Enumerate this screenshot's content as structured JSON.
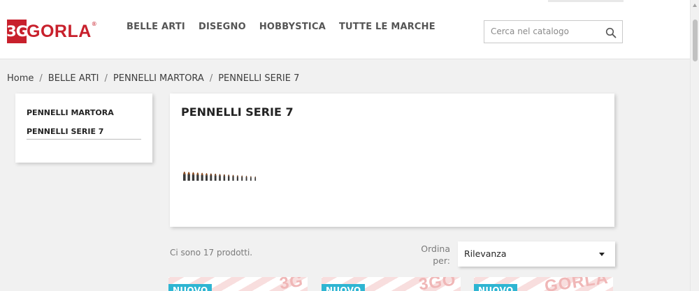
{
  "header": {
    "logo": {
      "prefix": "3G",
      "brand": "GORLA",
      "registered": "®"
    },
    "nav": [
      {
        "label": "BELLE ARTI"
      },
      {
        "label": "DISEGNO"
      },
      {
        "label": "HOBBYSTICA"
      },
      {
        "label": "TUTTE LE MARCHE"
      }
    ],
    "search": {
      "placeholder": "Cerca nel catalogo",
      "value": "",
      "icon": "search-icon"
    }
  },
  "breadcrumb": [
    "Home",
    "BELLE ARTI",
    "PENNELLI MARTORA",
    "PENNELLI SERIE 7"
  ],
  "breadcrumb_separator": "/",
  "sidebar": {
    "items": [
      {
        "label": "PENNELLI MARTORA"
      },
      {
        "label": "PENNELLI SERIE 7"
      }
    ]
  },
  "category": {
    "title": "PENNELLI SERIE 7",
    "image": "brushes-series-image"
  },
  "listing": {
    "count_text": "Ci sono 17 prodotti.",
    "sort_label": "Ordina per:",
    "sort_value": "Rilevanza"
  },
  "products": [
    {
      "badge": "NUOVO",
      "watermark": "3G"
    },
    {
      "badge": "NUOVO",
      "watermark": "3GO"
    },
    {
      "badge": "NUOVO",
      "watermark": "GORLA"
    }
  ],
  "colors": {
    "brand_red": "#c8202c",
    "badge_blue": "#2fb5d2"
  }
}
